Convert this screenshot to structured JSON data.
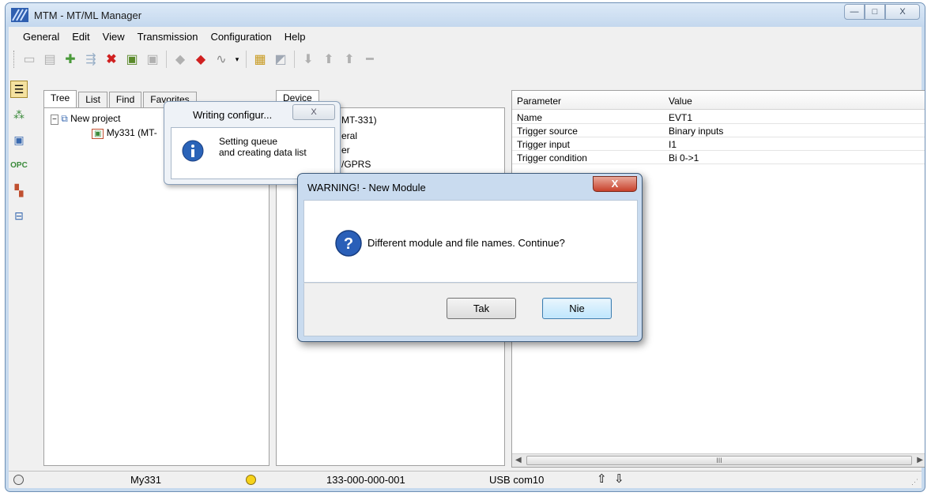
{
  "window": {
    "title": "MTM - MT/ML Manager",
    "caption_buttons": [
      "—",
      "□",
      "X"
    ]
  },
  "menu": [
    "General",
    "Edit",
    "View",
    "Transmission",
    "Configuration",
    "Help"
  ],
  "toolbar": {
    "icons": [
      "new-project-icon",
      "module-icon",
      "add-module-icon",
      "import-icon",
      "delete-icon",
      "write-config-icon",
      "read-config-icon",
      "connect-icon",
      "disconnect-icon",
      "link-icon",
      "open-icon",
      "settings-icon",
      "download-icon",
      "upload-icon",
      "upload2-icon",
      "remove-icon"
    ]
  },
  "left_tabs": [
    "Tree",
    "List",
    "Find",
    "Favorites"
  ],
  "tree": {
    "root": "New project",
    "child": "My331 (MT-"
  },
  "middle_tab": "Device",
  "device_tree": [
    "MT-331)",
    "eral",
    "er",
    "/GPRS"
  ],
  "grid": {
    "headers": [
      "Parameter",
      "Value"
    ],
    "rows": [
      {
        "param": "Name",
        "value": "EVT1"
      },
      {
        "param": "Trigger source",
        "value": "Binary inputs"
      },
      {
        "param": "Trigger input",
        "value": "I1"
      },
      {
        "param": "Trigger condition",
        "value": "Bi 0->1"
      }
    ],
    "scroll_label": "III"
  },
  "statusbar": {
    "module": "My331",
    "address": "133-000-000-001",
    "port": "USB com10"
  },
  "toast": {
    "title": "Writing configur...",
    "line1": "Setting queue",
    "line2": "and creating data list",
    "close": "X"
  },
  "dialog": {
    "title": "WARNING! - New Module",
    "message": "Different module and file names. Continue?",
    "yes": "Tak",
    "no": "Nie",
    "close": "X"
  },
  "colors": {
    "accent": "#3c7fb1",
    "led_on": "#f6d21a",
    "close_red": "#c8412b"
  }
}
